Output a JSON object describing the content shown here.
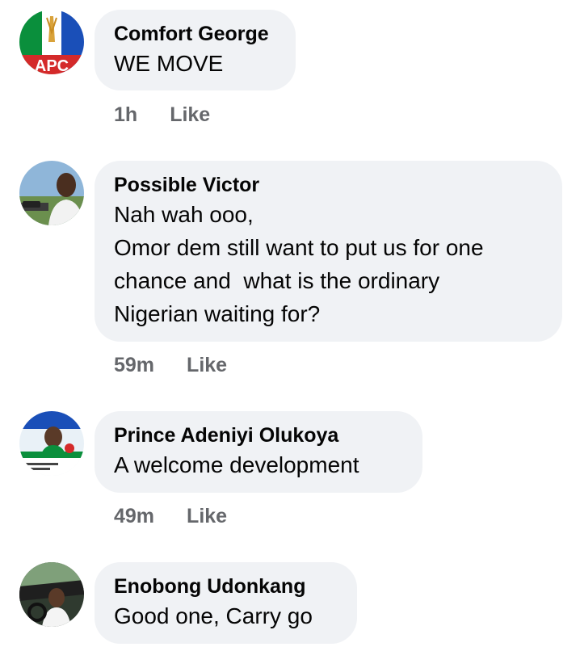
{
  "comments": [
    {
      "author": "Comfort George",
      "avatar_icon": "apc-party-logo-avatar",
      "lines": [
        "WE MOVE"
      ],
      "time": "1h",
      "like_label": "Like"
    },
    {
      "author": "Possible Victor",
      "avatar_icon": "user-photo-avatar",
      "lines": [
        "Nah wah ooo,",
        "Omor dem still want to put us for one",
        "chance and  what is the ordinary",
        "Nigerian waiting for?"
      ],
      "time": "59m",
      "like_label": "Like"
    },
    {
      "author": "Prince Adeniyi Olukoya",
      "avatar_icon": "campaign-poster-avatar",
      "lines": [
        "A welcome development"
      ],
      "time": "49m",
      "like_label": "Like"
    },
    {
      "author": "Enobong Udonkang",
      "avatar_icon": "user-in-car-avatar",
      "lines": [
        "Good one, Carry go"
      ],
      "time": "",
      "like_label": ""
    }
  ],
  "colors": {
    "bubble_bg": "#f0f2f5",
    "meta_text": "#65676b",
    "text": "#050505"
  }
}
